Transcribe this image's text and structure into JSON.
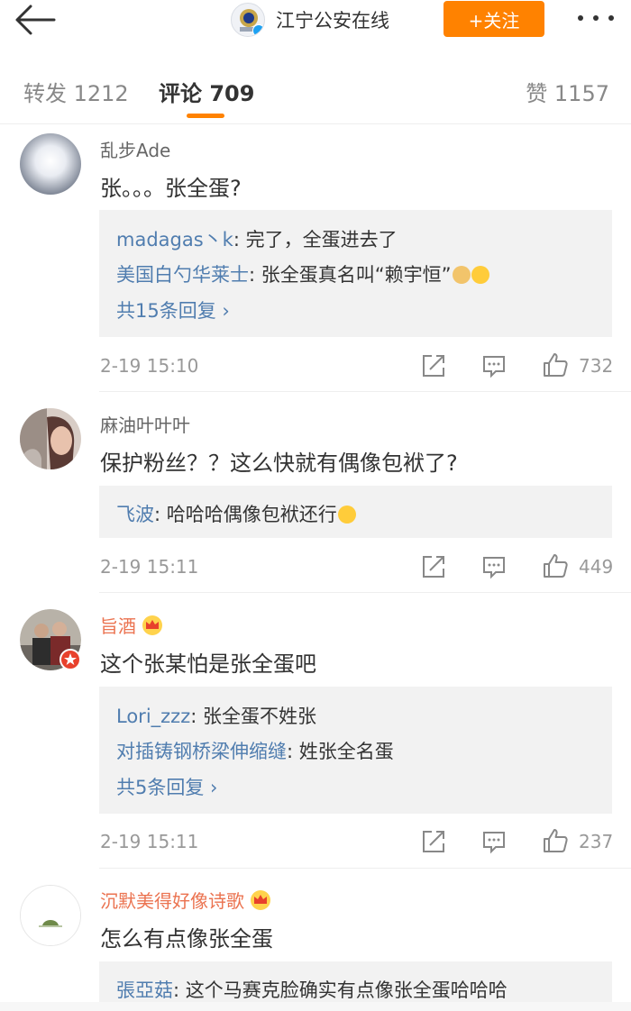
{
  "header": {
    "account_name": "江宁公安在线",
    "follow_label": "+关注",
    "back_icon": "back-arrow-icon",
    "more_icon": "more-dots-icon"
  },
  "tabs": {
    "repost": "转发 1212",
    "comment": "评论 709",
    "like": "赞 1157",
    "active": "comment",
    "accent_color": "#ff8200"
  },
  "colors": {
    "link": "#507daf",
    "vip_name": "#eb7350",
    "reply_bg": "#f2f2f2"
  },
  "comments": [
    {
      "user": "乱步Ade",
      "text": "张。。。张全蛋?",
      "replies": [
        {
          "name": "madagas丶k",
          "text": ": 完了，全蛋进去了"
        },
        {
          "name": "美国白勺华莱士",
          "text": ": 张全蛋真名叫“赖宇恒”"
        }
      ],
      "more_replies": "共15条回复 ›",
      "time": "2-19 15:10",
      "likes": "732"
    },
    {
      "user": "麻油叶叶叶",
      "text": "保护粉丝？？这么快就有偶像包袱了?",
      "replies": [
        {
          "name": "飞波",
          "text": ": 哈哈哈偶像包袱还行"
        }
      ],
      "time": "2-19 15:11",
      "likes": "449"
    },
    {
      "user": "旨酒",
      "text": "这个张某怕是张全蛋吧",
      "replies": [
        {
          "name": "Lori_zzz",
          "text": ": 张全蛋不姓张"
        },
        {
          "name": "对插铸钢桥梁伸缩缝",
          "text": ": 姓张全名蛋"
        }
      ],
      "more_replies": "共5条回复 ›",
      "time": "2-19 15:11",
      "likes": "237"
    },
    {
      "user": "沉默美得好像诗歌",
      "text": "怎么有点像张全蛋",
      "replies": [
        {
          "name": "張亞菇",
          "text": ": 这个马赛克脸确实有点像张全蛋哈哈哈"
        }
      ]
    }
  ]
}
